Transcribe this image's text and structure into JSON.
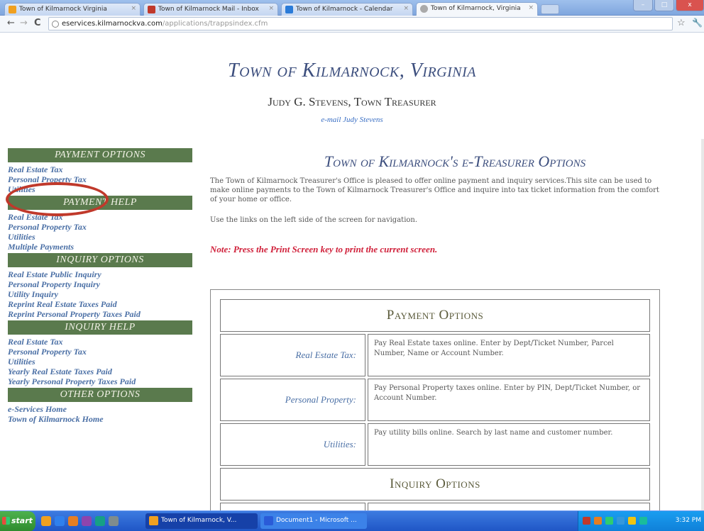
{
  "browser": {
    "tabs": [
      {
        "label": "Town of Kilmarnock Virginia",
        "icon_color": "#f0a020"
      },
      {
        "label": "Town of Kilmarnock Mail - Inbox",
        "icon_color": "#c0392b"
      },
      {
        "label": "Town of Kilmarnock - Calendar",
        "icon_color": "#2a7bd8"
      },
      {
        "label": "Town of Kilmarnock, Virginia",
        "icon_color": "#aaaaaa"
      }
    ],
    "url_host": "eservices.kilmarnockva.com",
    "url_path": "/applications/trappsindex.cfm",
    "window_buttons": [
      "–",
      "□",
      "x"
    ],
    "nav_back": "←",
    "nav_forward": "→",
    "nav_reload": "C"
  },
  "header": {
    "town_title": "Town of Kilmarnock, Virginia",
    "treasurer": "Judy G. Stevens, Town Treasurer",
    "email_link": "e-mail Judy Stevens"
  },
  "sidebar": {
    "payment_options": {
      "heading": "PAYMENT OPTIONS",
      "links": [
        "Real Estate Tax",
        "Personal Property Tax",
        "Utilities"
      ]
    },
    "payment_help": {
      "heading": "PAYMENT HELP",
      "links": [
        "Real Estate Tax",
        "Personal Property Tax",
        "Utilities",
        "Multiple Payments"
      ]
    },
    "inquiry_options": {
      "heading": "INQUIRY OPTIONS",
      "links": [
        "Real Estate Public Inquiry",
        "Personal Property Inquiry",
        "Utility Inquiry",
        "Reprint Real Estate Taxes Paid",
        "Reprint Personal Property Taxes Paid"
      ]
    },
    "inquiry_help": {
      "heading": "INQUIRY HELP",
      "links": [
        "Real Estate Tax",
        "Personal Property Tax",
        "Utilities",
        "Yearly Real Estate Taxes Paid",
        "Yearly Personal Property Taxes Paid"
      ]
    },
    "other_options": {
      "heading": "OTHER OPTIONS",
      "links": [
        "e-Services Home",
        "Town of Kilmarnock Home"
      ]
    }
  },
  "main": {
    "title": "Town of Kilmarnock's e-Treasurer Options",
    "intro": "The Town of Kilmarnock Treasurer's Office is pleased to offer online payment and inquiry services.This site can be used to make online payments to the Town of Kilmarnock Treasurer's Office and inquire into tax ticket information from the comfort of your home or office.",
    "nav_hint": "Use the links on the left side of the screen for navigation.",
    "note": "Note: Press the Print Screen key to print the current screen.",
    "payment_section": "Payment Options",
    "payment_rows": [
      {
        "label": "Real Estate Tax:",
        "desc": "Pay Real Estate taxes online. Enter by Dept/Ticket Number, Parcel Number, Name or Account Number."
      },
      {
        "label": "Personal Property:",
        "desc": "Pay Personal Property taxes online. Enter by PIN, Dept/Ticket Number, or Account Number."
      },
      {
        "label": "Utilities:",
        "desc": "Pay utility bills online. Search by last name and customer number."
      }
    ],
    "inquiry_section": "Inquiry Options"
  },
  "taskbar": {
    "start_label": "start",
    "tasks": [
      {
        "label": "Town of Kilmarnock, V...",
        "icon_color": "#f0a020"
      },
      {
        "label": "Document1 - Microsoft ...",
        "icon_color": "#2a5bd8"
      }
    ],
    "clock": "3:32 PM"
  },
  "colors": {
    "sidebar_heading_bg": "#5a7a4d",
    "link": "#4a6fa5",
    "title": "#3d4f7e",
    "note": "#d0203a",
    "highlight_ellipse": "#c0392b"
  }
}
